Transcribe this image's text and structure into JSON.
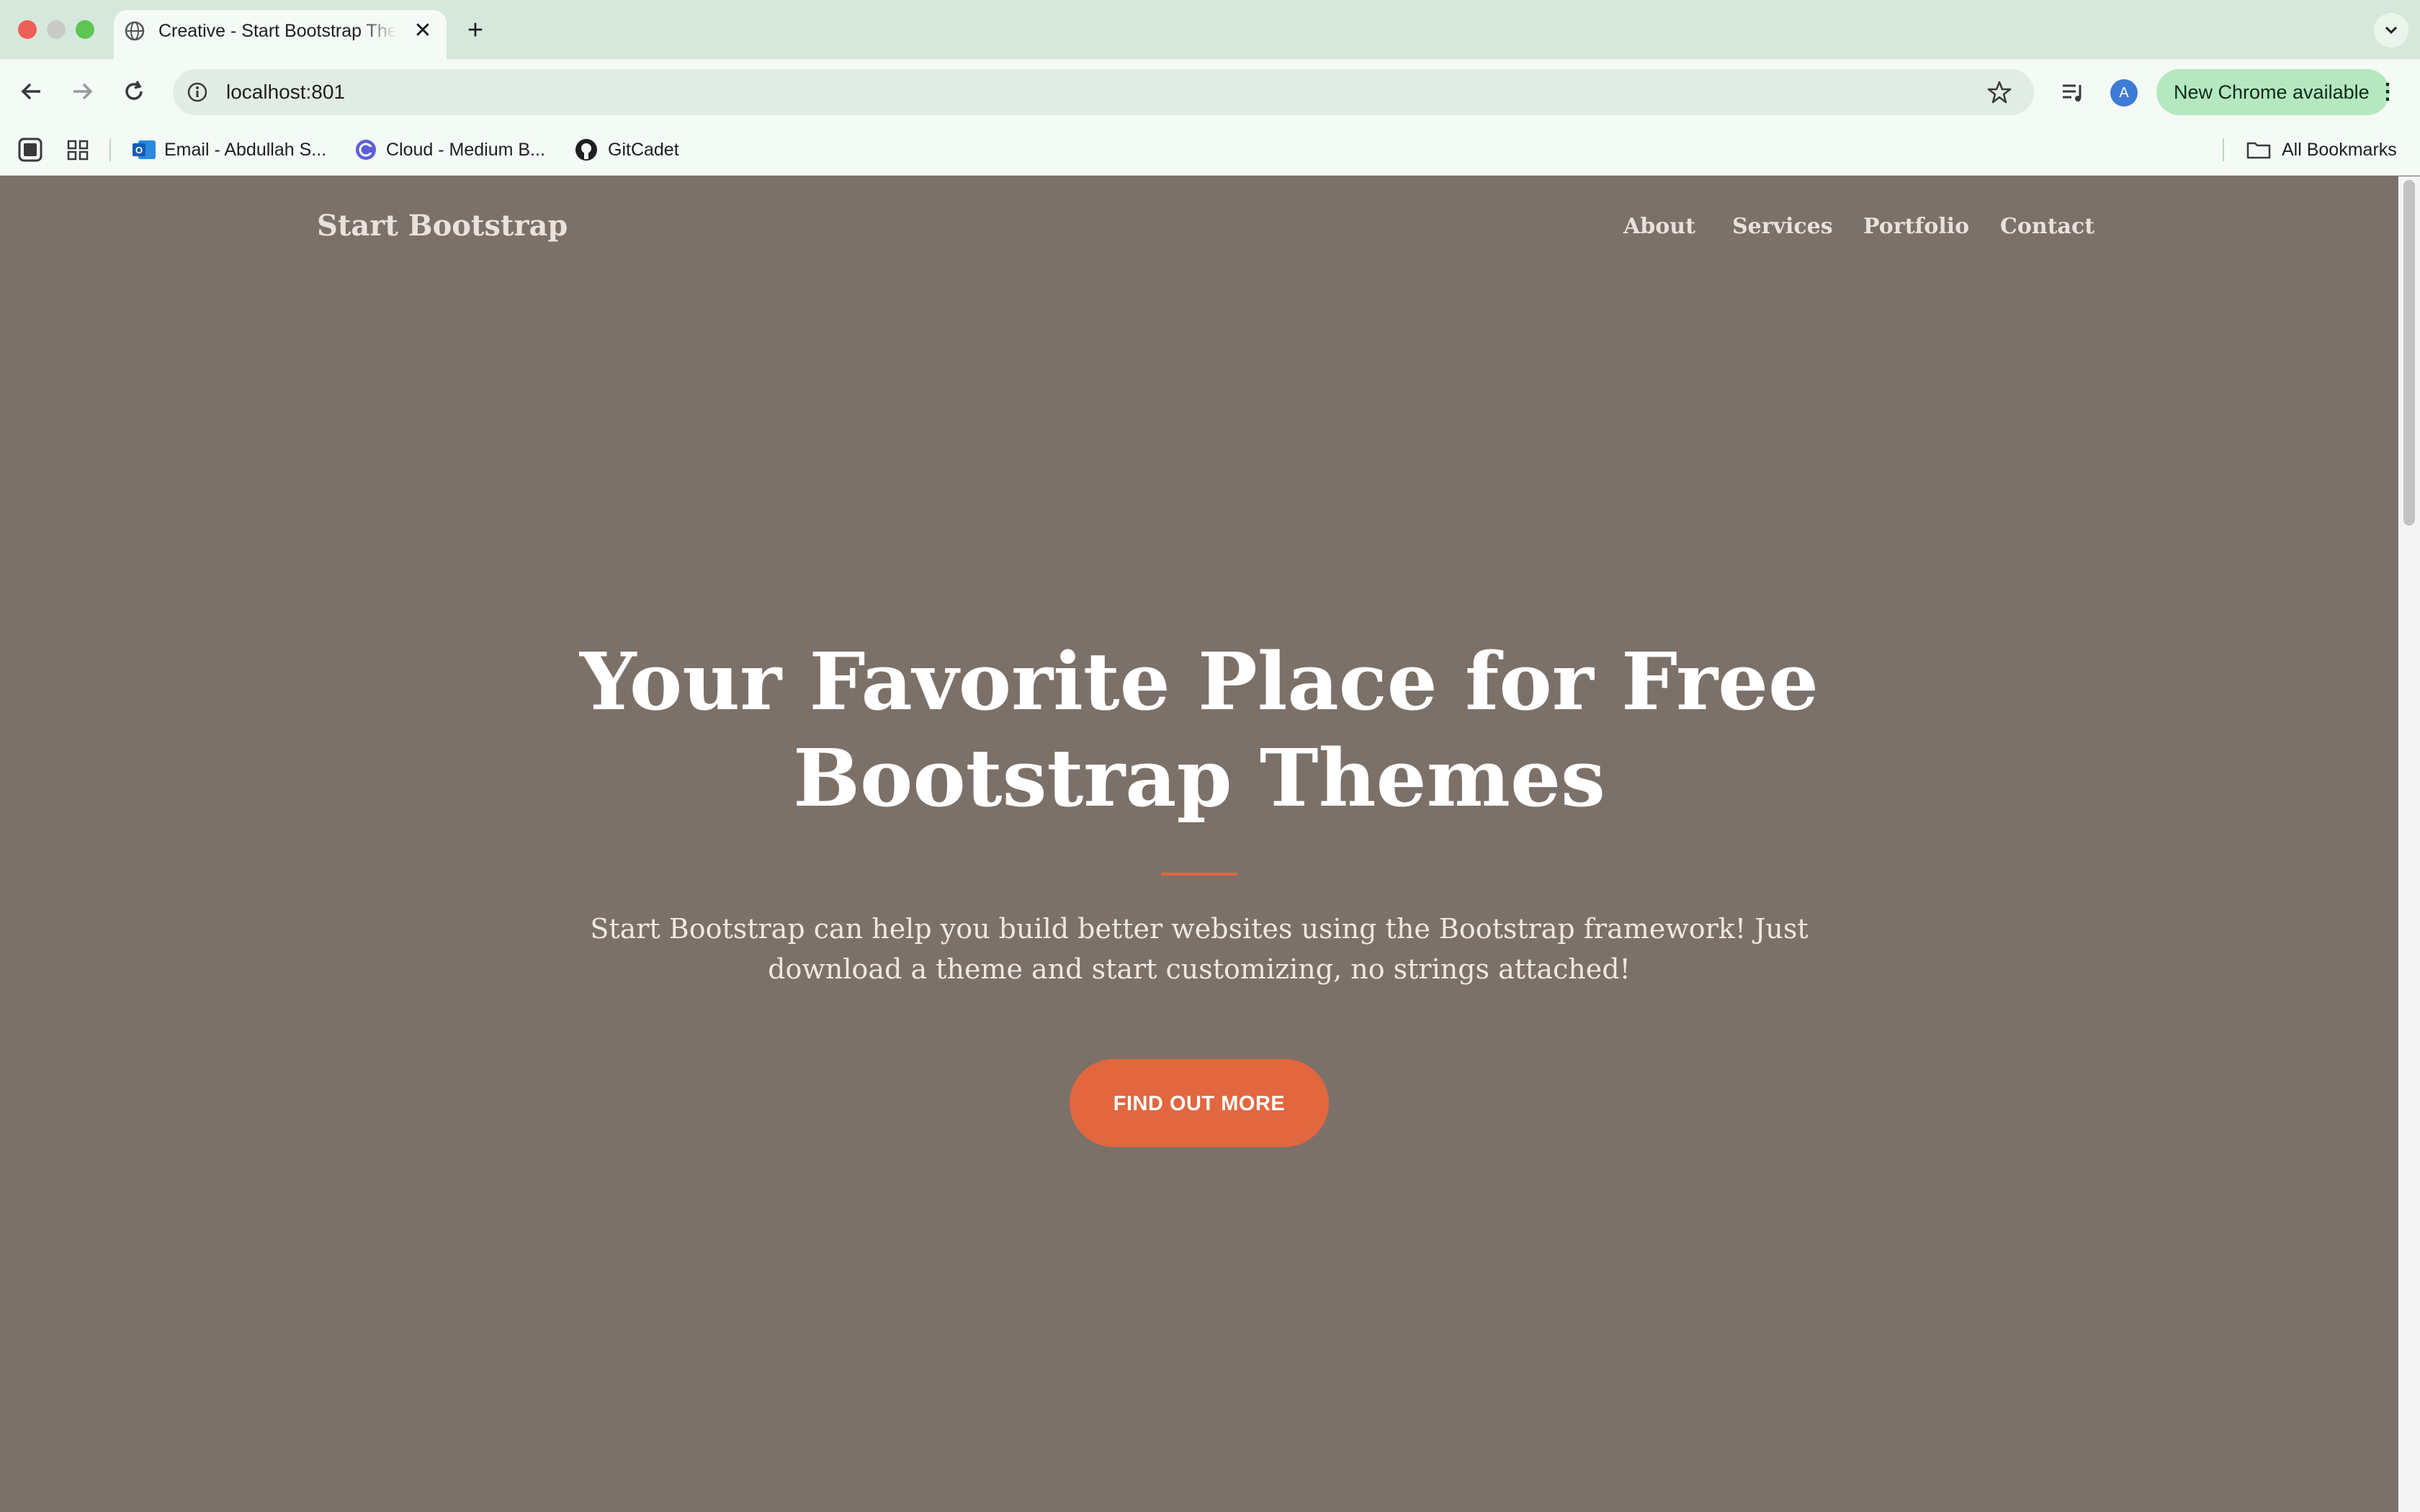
{
  "browser": {
    "tab_title": "Creative - Start Bootstrap Theme",
    "url": "localhost:801",
    "update_label": "New Chrome available",
    "avatar_initial": "A",
    "bookmarks": [
      {
        "label": "Email - Abdullah S...",
        "icon": "outlook-icon"
      },
      {
        "label": "Cloud - Medium B...",
        "icon": "cloud-icon"
      },
      {
        "label": "GitCadet",
        "icon": "github-icon"
      }
    ],
    "all_bookmarks_label": "All Bookmarks"
  },
  "page": {
    "brand": "Start Bootstrap",
    "nav": [
      "About",
      "Services",
      "Portfolio",
      "Contact"
    ],
    "hero": {
      "title": "Your Favorite Place for Free Bootstrap Themes",
      "subtitle": "Start Bootstrap can help you build better websites using the Bootstrap framework! Just download a theme and start customizing, no strings attached!",
      "cta_label": "FIND OUT MORE"
    }
  },
  "colors": {
    "hero_background": "#7b7169",
    "accent": "#e2673f",
    "browser_frame": "#d6e8dc",
    "update_pill": "#b5e8c1"
  }
}
